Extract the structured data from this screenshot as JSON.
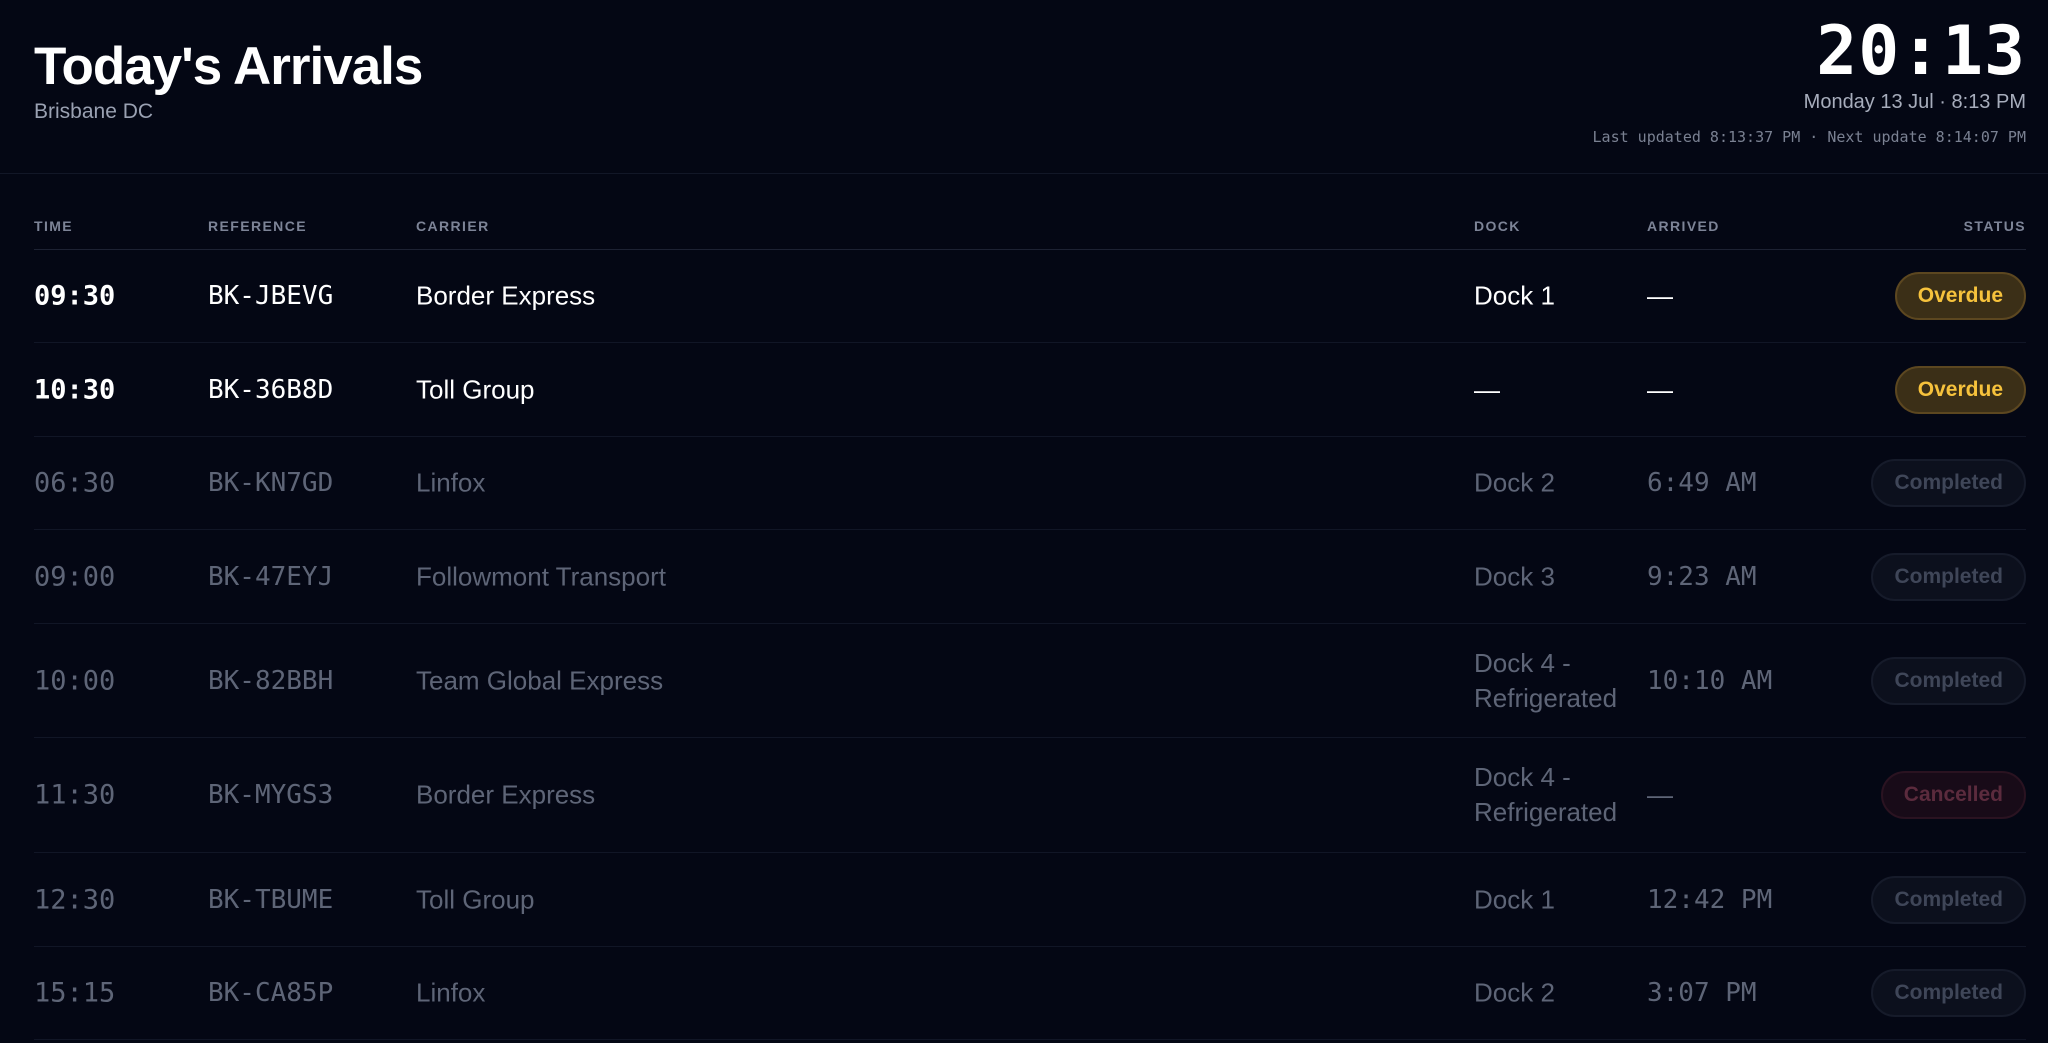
{
  "header": {
    "title": "Today's Arrivals",
    "subtitle": "Brisbane DC",
    "clock": "20:13",
    "date_line": "Monday 13 Jul · 8:13 PM",
    "updated_line": "Last updated 8:13:37 PM · Next update 8:14:07 PM"
  },
  "table": {
    "columns": {
      "time": "TIME",
      "reference": "REFERENCE",
      "carrier": "CARRIER",
      "dock": "DOCK",
      "arrived": "ARRIVED",
      "status": "STATUS"
    },
    "rows": [
      {
        "time": "09:30",
        "reference": "BK-JBEVG",
        "carrier": "Border Express",
        "dock": "Dock 1",
        "arrived": "—",
        "status": "Overdue"
      },
      {
        "time": "10:30",
        "reference": "BK-36B8D",
        "carrier": "Toll Group",
        "dock": "—",
        "arrived": "—",
        "status": "Overdue"
      },
      {
        "time": "06:30",
        "reference": "BK-KN7GD",
        "carrier": "Linfox",
        "dock": "Dock 2",
        "arrived": "6:49 AM",
        "status": "Completed"
      },
      {
        "time": "09:00",
        "reference": "BK-47EYJ",
        "carrier": "Followmont Transport",
        "dock": "Dock 3",
        "arrived": "9:23 AM",
        "status": "Completed"
      },
      {
        "time": "10:00",
        "reference": "BK-82BBH",
        "carrier": "Team Global Express",
        "dock": "Dock 4 - Refrigerated",
        "arrived": "10:10 AM",
        "status": "Completed"
      },
      {
        "time": "11:30",
        "reference": "BK-MYGS3",
        "carrier": "Border Express",
        "dock": "Dock 4 - Refrigerated",
        "arrived": "—",
        "status": "Cancelled"
      },
      {
        "time": "12:30",
        "reference": "BK-TBUME",
        "carrier": "Toll Group",
        "dock": "Dock 1",
        "arrived": "12:42 PM",
        "status": "Completed"
      },
      {
        "time": "15:15",
        "reference": "BK-CA85P",
        "carrier": "Linfox",
        "dock": "Dock 2",
        "arrived": "3:07 PM",
        "status": "Completed"
      }
    ]
  },
  "colors": {
    "background": "#040714",
    "overdue": "#f6c23c",
    "completed": "#3f4658",
    "cancelled": "#5b2b3d"
  }
}
